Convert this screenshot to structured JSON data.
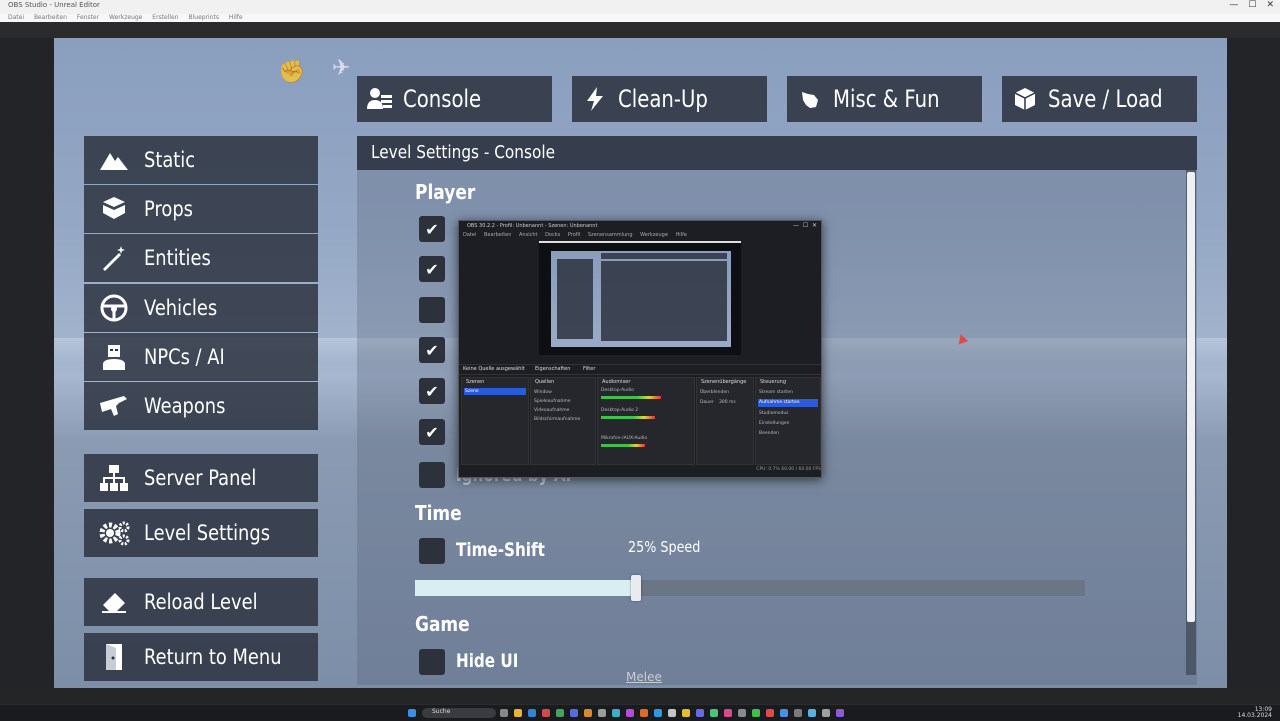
{
  "window": {
    "title": "OBS Studio - Unreal Editor",
    "controls": [
      "—",
      "☐",
      "✕"
    ]
  },
  "editor_menu": [
    "Datei",
    "Bearbeiten",
    "Fenster",
    "Werkzeuge",
    "Erstellen",
    "Blueprints",
    "Hilfe"
  ],
  "top_nav": [
    {
      "label": "Console",
      "icon": "console-user-icon"
    },
    {
      "label": "Clean-Up",
      "icon": "lightning-icon"
    },
    {
      "label": "Misc & Fun",
      "icon": "fist-icon"
    },
    {
      "label": "Save / Load",
      "icon": "box-icon"
    }
  ],
  "left_menu": [
    {
      "label": "Static",
      "icon": "mountain-icon"
    },
    {
      "label": "Props",
      "icon": "boxes-icon"
    },
    {
      "label": "Entities",
      "icon": "magic-wand-icon"
    },
    {
      "label": "Vehicles",
      "icon": "steering-wheel-icon"
    },
    {
      "label": "NPCs / AI",
      "icon": "npc-icon"
    },
    {
      "label": "Weapons",
      "icon": "gun-icon"
    },
    {
      "label": "Server Panel",
      "icon": "network-icon"
    },
    {
      "label": "Level Settings",
      "icon": "gears-icon"
    },
    {
      "label": "Reload Level",
      "icon": "eraser-icon"
    },
    {
      "label": "Return to Menu",
      "icon": "exit-door-icon"
    }
  ],
  "panel": {
    "title": "Level Settings - Console",
    "player_section": "Player",
    "player_options": [
      {
        "checked": true
      },
      {
        "checked": true
      },
      {
        "checked": false
      },
      {
        "checked": true
      },
      {
        "checked": true
      },
      {
        "checked": true
      },
      {
        "checked": false,
        "label": "Ignored by AI"
      }
    ],
    "time_section": "Time",
    "timeshift_label": "Time-Shift",
    "timeshift_checked": false,
    "speed_label": "25% Speed",
    "speed_fraction": 0.33,
    "game_section": "Game",
    "hideui_label": "Hide UI",
    "hideui_checked": false,
    "melee_label": "Melee"
  },
  "obs": {
    "title": "OBS 30.2.2 - Profil: Unbenannt - Szenen: Unbenannt",
    "menu": [
      "Datei",
      "Bearbeiten",
      "Ansicht",
      "Docks",
      "Profil",
      "Szenensammlung",
      "Werkzeuge",
      "Hilfe"
    ],
    "tabs": {
      "none_selected": "Keine Quelle ausgewählt",
      "properties": "Eigenschaften",
      "filters": "Filter"
    },
    "docks": {
      "scenes": "Szenen",
      "sources": "Quellen",
      "audio_mixer": "Audiomixer",
      "transitions": "Szenenübergänge",
      "controls": "Steuerung"
    },
    "scene_item": "Szene",
    "source_items": [
      "Window",
      "Spieleaufnahme",
      "Videoaufnahme",
      "Bildschirmaufnahme"
    ],
    "audio_items": [
      "Desktop-Audio",
      "Desktop-Audio 2",
      "Mikrofon-/AUX-Audio"
    ],
    "transition_items": [
      "Überblenden",
      "Dauer",
      "300 ms"
    ],
    "control_items": [
      "Stream starten",
      "Aufnahme starten",
      "Studiomodus",
      "Einstellungen",
      "Beenden"
    ],
    "status": "CPU: 0.7%   60.00 / 60.00 FPS"
  },
  "taskbar": {
    "search": "Suche",
    "time": "13:09",
    "date": "14.03.2024"
  },
  "colors": {
    "panel": "#2c323f",
    "slider_fill": "#d9eef1",
    "accent_obs": "#2a5bd8"
  }
}
